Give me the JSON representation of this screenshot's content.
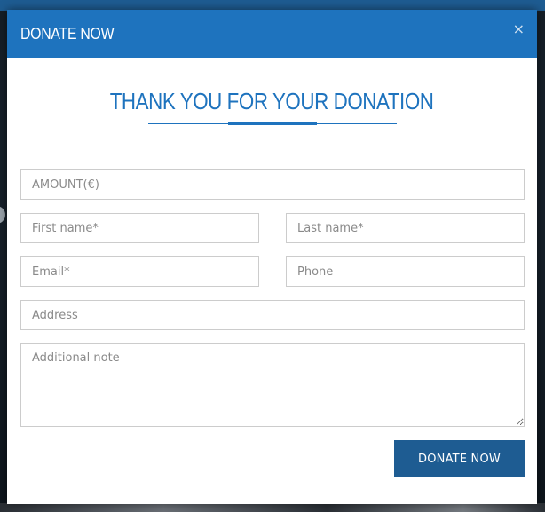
{
  "modal": {
    "title": "DONATE NOW",
    "close_glyph": "×",
    "heading": "THANK YOU FOR YOUR DONATION"
  },
  "form": {
    "amount_placeholder": "AMOUNT(€)",
    "first_name_placeholder": "First name*",
    "last_name_placeholder": "Last name*",
    "email_placeholder": "Email*",
    "phone_placeholder": "Phone",
    "address_placeholder": "Address",
    "note_placeholder": "Additional note",
    "submit_label": "DONATE NOW"
  },
  "colors": {
    "header_bg": "#1e73be",
    "accent": "#1e73be",
    "button_bg": "#1e5c92"
  }
}
